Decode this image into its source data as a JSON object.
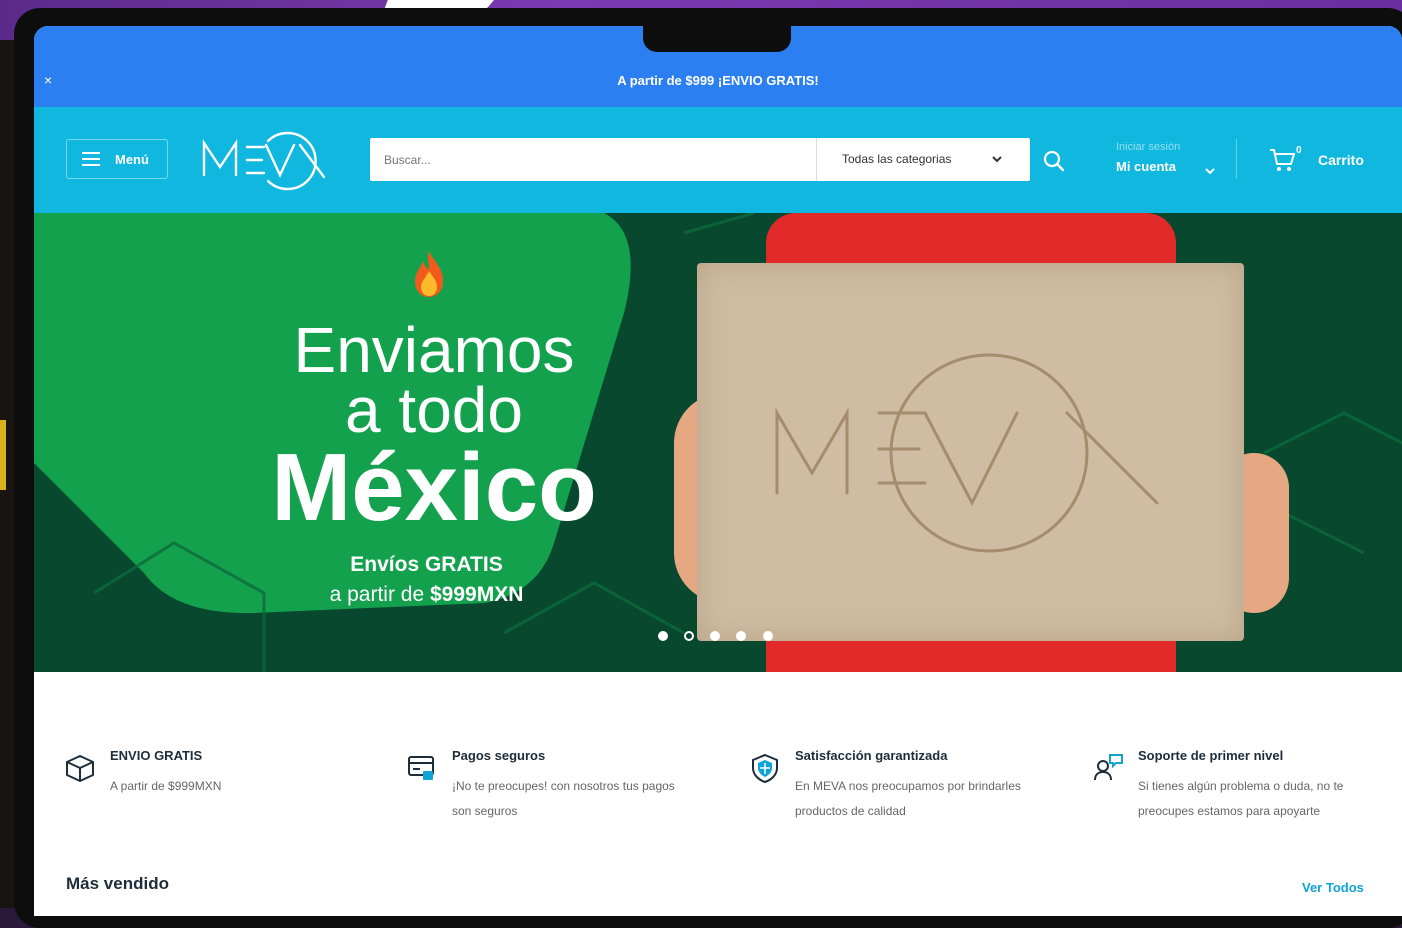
{
  "announcement": {
    "close": "×",
    "text": "A partir de $999 ¡ENVIO GRATIS!"
  },
  "header": {
    "menu_label": "Menú",
    "logo_text": "MEVA",
    "search_placeholder": "Buscar...",
    "category_label": "Todas las categorias",
    "account_small": "Iniciar sesión",
    "account_label": "Mi cuenta",
    "cart_count": "0",
    "cart_label": "Carrito"
  },
  "hero": {
    "line1": "Enviamos",
    "line2": "a todo",
    "line3": "México",
    "sub1": "Envíos GRATIS",
    "sub2_prefix": "a partir de ",
    "sub2_amount": "$999MXN",
    "box_logo": "MEVA",
    "slide_count": 5,
    "active_slide": 2
  },
  "features": [
    {
      "icon": "box-icon",
      "title": "ENVIO GRATIS",
      "desc": "A partir de $999MXN"
    },
    {
      "icon": "payment-icon",
      "title": "Pagos seguros",
      "desc": "¡No te preocupes! con nosotros tus pagos son seguros"
    },
    {
      "icon": "shield-icon",
      "title": "Satisfacción garantizada",
      "desc": "En MEVA nos preocupamos por brindarles productos de calidad"
    },
    {
      "icon": "support-icon",
      "title": "Soporte de primer nivel",
      "desc": "Si tienes algún problema o duda, no te preocupes estamos para apoyarte"
    }
  ],
  "best_sellers": {
    "title": "Más vendido",
    "view_all": "Ver Todos"
  },
  "colors": {
    "announce": "#2b7ff0",
    "header": "#10b7df",
    "hero_bg": "#07482e",
    "hero_green": "#14a14e",
    "link": "#10a3d6"
  }
}
